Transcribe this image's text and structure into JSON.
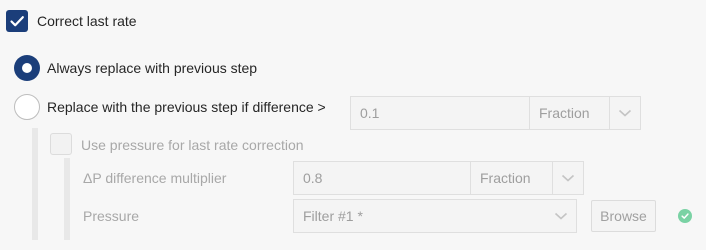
{
  "correct_last_rate": {
    "label": "Correct last rate",
    "checked": true
  },
  "radio_always": {
    "label": "Always replace with previous step",
    "selected": true
  },
  "radio_difference": {
    "label": "Replace with the previous step if difference >",
    "selected": false,
    "value": "0.1",
    "unit": "Fraction"
  },
  "use_pressure": {
    "label": "Use pressure for last rate correction",
    "checked": false
  },
  "dp_multiplier": {
    "label": "ΔP difference multiplier",
    "value": "0.8",
    "unit": "Fraction"
  },
  "pressure": {
    "label": "Pressure",
    "value": "Filter #1 *",
    "browse_label": "Browse"
  },
  "colors": {
    "accent": "#1b3e7a",
    "status_ok": "#7ad2a4",
    "disabled_text": "#a8a8a8"
  },
  "icons": [
    "checkmark-icon",
    "chevron-down-icon",
    "status-ok-icon"
  ]
}
